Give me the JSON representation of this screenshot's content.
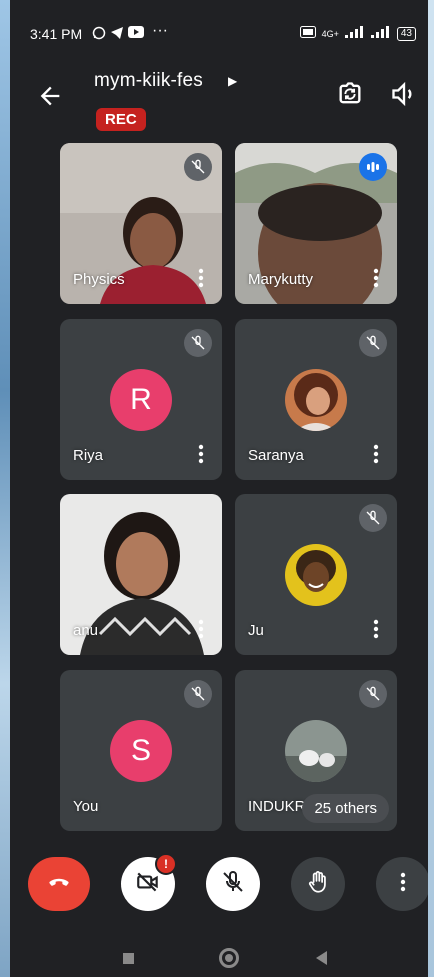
{
  "status": {
    "time": "3:41 PM",
    "network": "4G+",
    "battery": "43"
  },
  "meeting": {
    "code": "mym-kiik-fes",
    "rec_label": "REC"
  },
  "tiles": [
    {
      "name": "Physics"
    },
    {
      "name": "Marykutty"
    },
    {
      "name": "Riya",
      "initial": "R"
    },
    {
      "name": "Saranya"
    },
    {
      "name": "anu"
    },
    {
      "name": "Ju"
    },
    {
      "name": "You",
      "initial": "S"
    },
    {
      "name": "INDUKRI",
      "others": "25 others"
    }
  ],
  "colors": {
    "end_call": "#ea4335",
    "rec": "#c5221f",
    "avatar_pink": "#e83e6c",
    "speaking": "#1a73e8"
  },
  "icons": {
    "back": "arrow-left-icon",
    "flip_camera": "camera-flip-icon",
    "speaker": "speaker-icon",
    "end_call": "phone-hangup-icon",
    "camera_off": "video-off-icon",
    "mic_off": "mic-off-icon",
    "raise_hand": "hand-icon",
    "more": "more-vert-icon"
  },
  "controls": {
    "camera_notice": "!"
  }
}
